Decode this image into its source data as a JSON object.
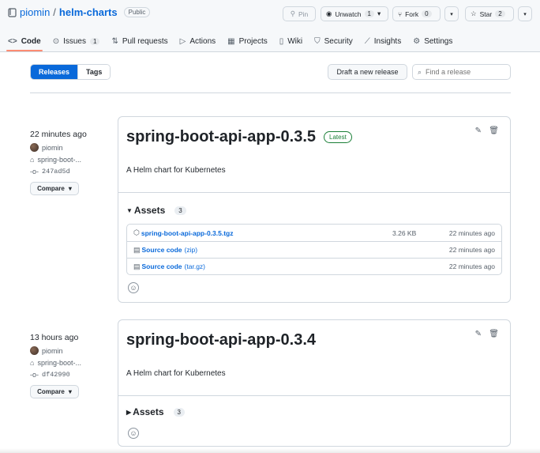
{
  "repo": {
    "owner": "piomin",
    "separator": "/",
    "name": "helm-charts",
    "visibility": "Public"
  },
  "actions": {
    "pin": "Pin",
    "unwatch": "Unwatch",
    "unwatch_count": "1",
    "fork": "Fork",
    "fork_count": "0",
    "star": "Star",
    "star_count": "2"
  },
  "tabs": [
    {
      "label": "Code",
      "icon": "code-icon"
    },
    {
      "label": "Issues",
      "icon": "issue-icon",
      "count": "1"
    },
    {
      "label": "Pull requests",
      "icon": "pull-request-icon"
    },
    {
      "label": "Actions",
      "icon": "play-icon"
    },
    {
      "label": "Projects",
      "icon": "table-icon"
    },
    {
      "label": "Wiki",
      "icon": "book-icon"
    },
    {
      "label": "Security",
      "icon": "shield-icon"
    },
    {
      "label": "Insights",
      "icon": "graph-icon"
    },
    {
      "label": "Settings",
      "icon": "gear-icon"
    }
  ],
  "toolbar": {
    "releases": "Releases",
    "tags": "Tags",
    "draft": "Draft a new release",
    "search_placeholder": "Find a release"
  },
  "releases": [
    {
      "time": "22 minutes ago",
      "author": "piomin",
      "tag": "spring-boot-...",
      "commit": "247ad5d",
      "compare": "Compare",
      "title": "spring-boot-api-app-0.3.5",
      "badge": "Latest",
      "description": "A Helm chart for Kubernetes",
      "assets_label": "Assets",
      "assets_count": "3",
      "assets": [
        {
          "name": "spring-boot-api-app-0.3.5.tgz",
          "sub": "",
          "size": "3.26 KB",
          "time": "22 minutes ago"
        },
        {
          "name": "Source code",
          "sub": "(zip)",
          "size": "",
          "time": "22 minutes ago"
        },
        {
          "name": "Source code",
          "sub": "(tar.gz)",
          "size": "",
          "time": "22 minutes ago"
        }
      ]
    },
    {
      "time": "13 hours ago",
      "author": "piomin",
      "tag": "spring-boot-...",
      "commit": "df42990",
      "compare": "Compare",
      "title": "spring-boot-api-app-0.3.4",
      "description": "A Helm chart for Kubernetes",
      "assets_label": "Assets",
      "assets_count": "3"
    }
  ],
  "colors": {
    "accent": "#0969da",
    "latest": "#1a7f37",
    "tab_underline": "#fd8c73"
  }
}
